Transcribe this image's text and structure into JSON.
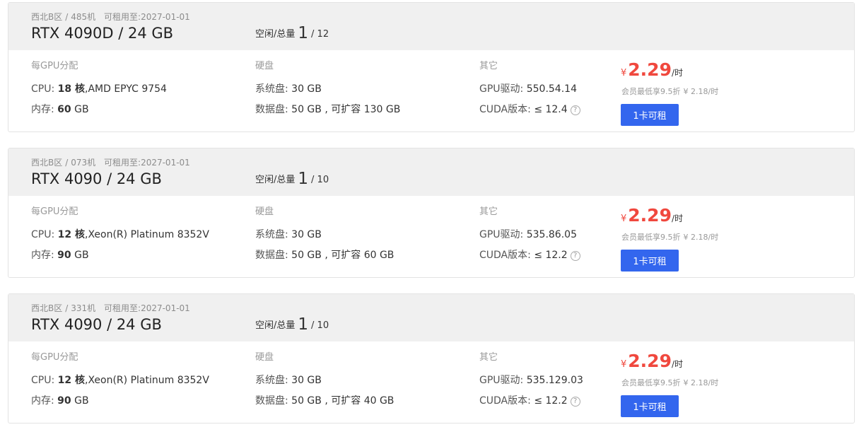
{
  "cards": [
    {
      "region": "西北B区",
      "machine": "485机",
      "rentable_label": "可租用至:",
      "rentable_until": "2027-01-01",
      "title": "RTX 4090D / 24 GB",
      "avail_label": "空闲/总量",
      "free": "1",
      "total": "/ 12",
      "per_gpu_header": "每GPU分配",
      "cpu_label": "CPU:",
      "cpu_cores": "18 核",
      "cpu_model": ",AMD EPYC 9754",
      "mem_label": "内存:",
      "mem_value": "60",
      "mem_unit": "GB",
      "disk_header": "硬盘",
      "sys_disk_label": "系统盘:",
      "sys_disk_value": "30 GB",
      "data_disk_label": "数据盘:",
      "data_disk_value": "50 GB , 可扩容 130 GB",
      "other_header": "其它",
      "driver_label": "GPU驱动:",
      "driver_value": "550.54.14",
      "cuda_label": "CUDA版本:",
      "cuda_value": "≤ 12.4",
      "currency": "¥",
      "price": "2.29",
      "price_unit": "/时",
      "member_text": "会员最低享9.5折",
      "member_price": "¥ 2.18/时",
      "rent_button": "1卡可租"
    },
    {
      "region": "西北B区",
      "machine": "073机",
      "rentable_label": "可租用至:",
      "rentable_until": "2027-01-01",
      "title": "RTX 4090 / 24 GB",
      "avail_label": "空闲/总量",
      "free": "1",
      "total": "/ 10",
      "per_gpu_header": "每GPU分配",
      "cpu_label": "CPU:",
      "cpu_cores": "12 核",
      "cpu_model": ",Xeon(R) Platinum 8352V",
      "mem_label": "内存:",
      "mem_value": "90",
      "mem_unit": "GB",
      "disk_header": "硬盘",
      "sys_disk_label": "系统盘:",
      "sys_disk_value": "30 GB",
      "data_disk_label": "数据盘:",
      "data_disk_value": "50 GB , 可扩容 60 GB",
      "other_header": "其它",
      "driver_label": "GPU驱动:",
      "driver_value": "535.86.05",
      "cuda_label": "CUDA版本:",
      "cuda_value": "≤ 12.2",
      "currency": "¥",
      "price": "2.29",
      "price_unit": "/时",
      "member_text": "会员最低享9.5折",
      "member_price": "¥ 2.18/时",
      "rent_button": "1卡可租"
    },
    {
      "region": "西北B区",
      "machine": "331机",
      "rentable_label": "可租用至:",
      "rentable_until": "2027-01-01",
      "title": "RTX 4090 / 24 GB",
      "avail_label": "空闲/总量",
      "free": "1",
      "total": "/ 10",
      "per_gpu_header": "每GPU分配",
      "cpu_label": "CPU:",
      "cpu_cores": "12 核",
      "cpu_model": ",Xeon(R) Platinum 8352V",
      "mem_label": "内存:",
      "mem_value": "90",
      "mem_unit": "GB",
      "disk_header": "硬盘",
      "sys_disk_label": "系统盘:",
      "sys_disk_value": "30 GB",
      "data_disk_label": "数据盘:",
      "data_disk_value": "50 GB , 可扩容 40 GB",
      "other_header": "其它",
      "driver_label": "GPU驱动:",
      "driver_value": "535.129.03",
      "cuda_label": "CUDA版本:",
      "cuda_value": "≤ 12.2",
      "currency": "¥",
      "price": "2.29",
      "price_unit": "/时",
      "member_text": "会员最低享9.5折",
      "member_price": "¥ 2.18/时",
      "rent_button": "1卡可租"
    }
  ],
  "icons": {
    "help": "question-circle-icon"
  },
  "colors": {
    "price": "#f0483e",
    "button": "#3366ee",
    "header_bg": "#f0f0f0"
  }
}
